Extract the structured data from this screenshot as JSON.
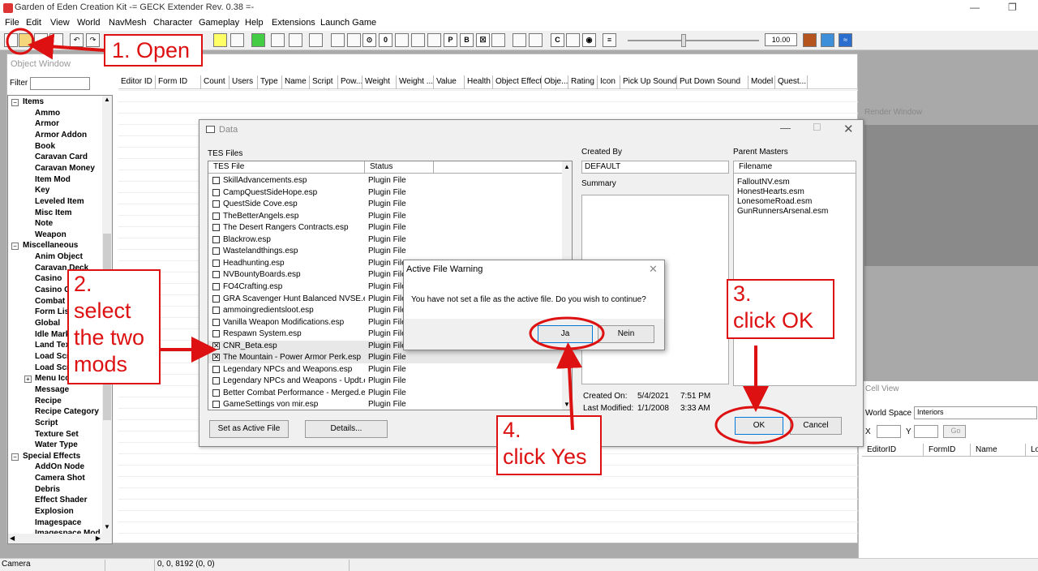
{
  "window": {
    "title": "Garden of Eden Creation Kit -= GECK Extender Rev. 0.38 =-",
    "minimize": "—",
    "restore": "❐"
  },
  "menu": [
    "File",
    "Edit",
    "View",
    "World",
    "NavMesh",
    "Character",
    "Gameplay",
    "Help",
    "Extensions",
    "Launch Game"
  ],
  "toolbar": {
    "zoom_value": "10.00"
  },
  "object_window": {
    "title": "Object Window",
    "filter_label": "Filter",
    "columns": [
      "Editor ID",
      "Form ID",
      "Count",
      "Users",
      "Type",
      "Name",
      "Script",
      "Pow...",
      "Weight",
      "Weight ...",
      "Value",
      "Health",
      "Object Effect",
      "Obje...",
      "Rating",
      "Icon",
      "Pick Up Sound",
      "Put Down Sound",
      "Model",
      "Quest..."
    ],
    "tree": [
      {
        "label": "Items",
        "level": 0,
        "expander": "−"
      },
      {
        "label": "Ammo",
        "level": 1
      },
      {
        "label": "Armor",
        "level": 1
      },
      {
        "label": "Armor Addon",
        "level": 1
      },
      {
        "label": "Book",
        "level": 1
      },
      {
        "label": "Caravan Card",
        "level": 1
      },
      {
        "label": "Caravan Money",
        "level": 1
      },
      {
        "label": "Item Mod",
        "level": 1
      },
      {
        "label": "Key",
        "level": 1
      },
      {
        "label": "Leveled Item",
        "level": 1
      },
      {
        "label": "Misc Item",
        "level": 1
      },
      {
        "label": "Note",
        "level": 1
      },
      {
        "label": "Weapon",
        "level": 1
      },
      {
        "label": "Miscellaneous",
        "level": 0,
        "expander": "−"
      },
      {
        "label": "Anim Object",
        "level": 1
      },
      {
        "label": "Caravan Deck",
        "level": 1
      },
      {
        "label": "Casino",
        "level": 1
      },
      {
        "label": "Casino Ch",
        "level": 1
      },
      {
        "label": "Combat St",
        "level": 1
      },
      {
        "label": "Form List",
        "level": 1
      },
      {
        "label": "Global",
        "level": 1
      },
      {
        "label": "Idle Marke",
        "level": 1
      },
      {
        "label": "Land Text",
        "level": 1
      },
      {
        "label": "Load Scre",
        "level": 1
      },
      {
        "label": "Load Scre",
        "level": 1
      },
      {
        "label": "Menu Icon",
        "level": 1,
        "expander": "+"
      },
      {
        "label": "Message",
        "level": 1
      },
      {
        "label": "Recipe",
        "level": 1
      },
      {
        "label": "Recipe Category",
        "level": 1
      },
      {
        "label": "Script",
        "level": 1
      },
      {
        "label": "Texture Set",
        "level": 1
      },
      {
        "label": "Water Type",
        "level": 1
      },
      {
        "label": "Special Effects",
        "level": 0,
        "expander": "−"
      },
      {
        "label": "AddOn Node",
        "level": 1
      },
      {
        "label": "Camera Shot",
        "level": 1
      },
      {
        "label": "Debris",
        "level": 1
      },
      {
        "label": "Effect Shader",
        "level": 1
      },
      {
        "label": "Explosion",
        "level": 1
      },
      {
        "label": "Imagespace",
        "level": 1
      },
      {
        "label": "Imagespace Mod",
        "level": 1
      }
    ]
  },
  "render_window": {
    "title": "Render Window"
  },
  "cell_view": {
    "title": "Cell View",
    "world_space_label": "World Space",
    "world_space_value": "Interiors",
    "x_label": "X",
    "y_label": "Y",
    "go_label": "Go",
    "columns": [
      "EditorID",
      "FormID",
      "Name",
      "Lo"
    ]
  },
  "status_bar": {
    "mode": "Camera",
    "coords": "0, 0, 8192 (0, 0)"
  },
  "data_dialog": {
    "title": "Data",
    "tes_files_label": "TES Files",
    "col_file": "TES File",
    "col_status": "Status",
    "files": [
      {
        "name": "SkillAdvancements.esp",
        "status": "Plugin File",
        "checked": false
      },
      {
        "name": "CampQuestSideHope.esp",
        "status": "Plugin File",
        "checked": false
      },
      {
        "name": "QuestSide Cove.esp",
        "status": "Plugin File",
        "checked": false
      },
      {
        "name": "TheBetterAngels.esp",
        "status": "Plugin File",
        "checked": false
      },
      {
        "name": "The Desert Rangers Contracts.esp",
        "status": "Plugin File",
        "checked": false
      },
      {
        "name": "Blackrow.esp",
        "status": "Plugin File",
        "checked": false
      },
      {
        "name": "Wastelandthings.esp",
        "status": "Plugin File",
        "checked": false
      },
      {
        "name": "Headhunting.esp",
        "status": "Plugin File",
        "checked": false
      },
      {
        "name": "NVBountyBoards.esp",
        "status": "Plugin File",
        "checked": false
      },
      {
        "name": "FO4Crafting.esp",
        "status": "Plugin File",
        "checked": false
      },
      {
        "name": "GRA Scavenger Hunt Balanced NVSE.e...",
        "status": "Plugin File",
        "checked": false
      },
      {
        "name": "ammoingredientsloot.esp",
        "status": "Plugin File",
        "checked": false
      },
      {
        "name": "Vanilla Weapon Modifications.esp",
        "status": "Plugin File",
        "checked": false
      },
      {
        "name": "Respawn System.esp",
        "status": "Plugin File",
        "checked": false
      },
      {
        "name": "CNR_Beta.esp",
        "status": "Plugin File",
        "checked": true
      },
      {
        "name": "The Mountain - Power Armor Perk.esp",
        "status": "Plugin File",
        "checked": true
      },
      {
        "name": "Legendary NPCs and Weapons.esp",
        "status": "Plugin File",
        "checked": false
      },
      {
        "name": "Legendary NPCs and Weapons - Updt.esp",
        "status": "Plugin File",
        "checked": false
      },
      {
        "name": "Better Combat Performance - Merged.esp",
        "status": "Plugin File",
        "checked": false
      },
      {
        "name": "GameSettings von mir.esp",
        "status": "Plugin File",
        "checked": false
      }
    ],
    "created_by_label": "Created By",
    "created_by_value": "DEFAULT",
    "summary_label": "Summary",
    "parent_masters_label": "Parent Masters",
    "masters_col": "Filename",
    "masters": [
      "FalloutNV.esm",
      "HonestHearts.esm",
      "LonesomeRoad.esm",
      "GunRunnersArsenal.esm"
    ],
    "created_on_label": "Created On:",
    "created_on_date": "5/4/2021",
    "created_on_time": "7:51 PM",
    "modified_label": "Last Modified:",
    "modified_date": "1/1/2008",
    "modified_time": "3:33 AM",
    "set_active_button": "Set as Active File",
    "details_button": "Details...",
    "ok_button": "OK",
    "cancel_button": "Cancel"
  },
  "warning_dialog": {
    "title": "Active File Warning",
    "message": "You have not set a file as the active file. Do you wish to continue?",
    "yes_button": "Ja",
    "no_button": "Nein"
  },
  "annotations": {
    "step1": "1. Open",
    "step2": "2.\nselect\nthe two\nmods",
    "step3": "3.\nclick OK",
    "step4": "4.\nclick Yes",
    "color": "#dd1111"
  }
}
